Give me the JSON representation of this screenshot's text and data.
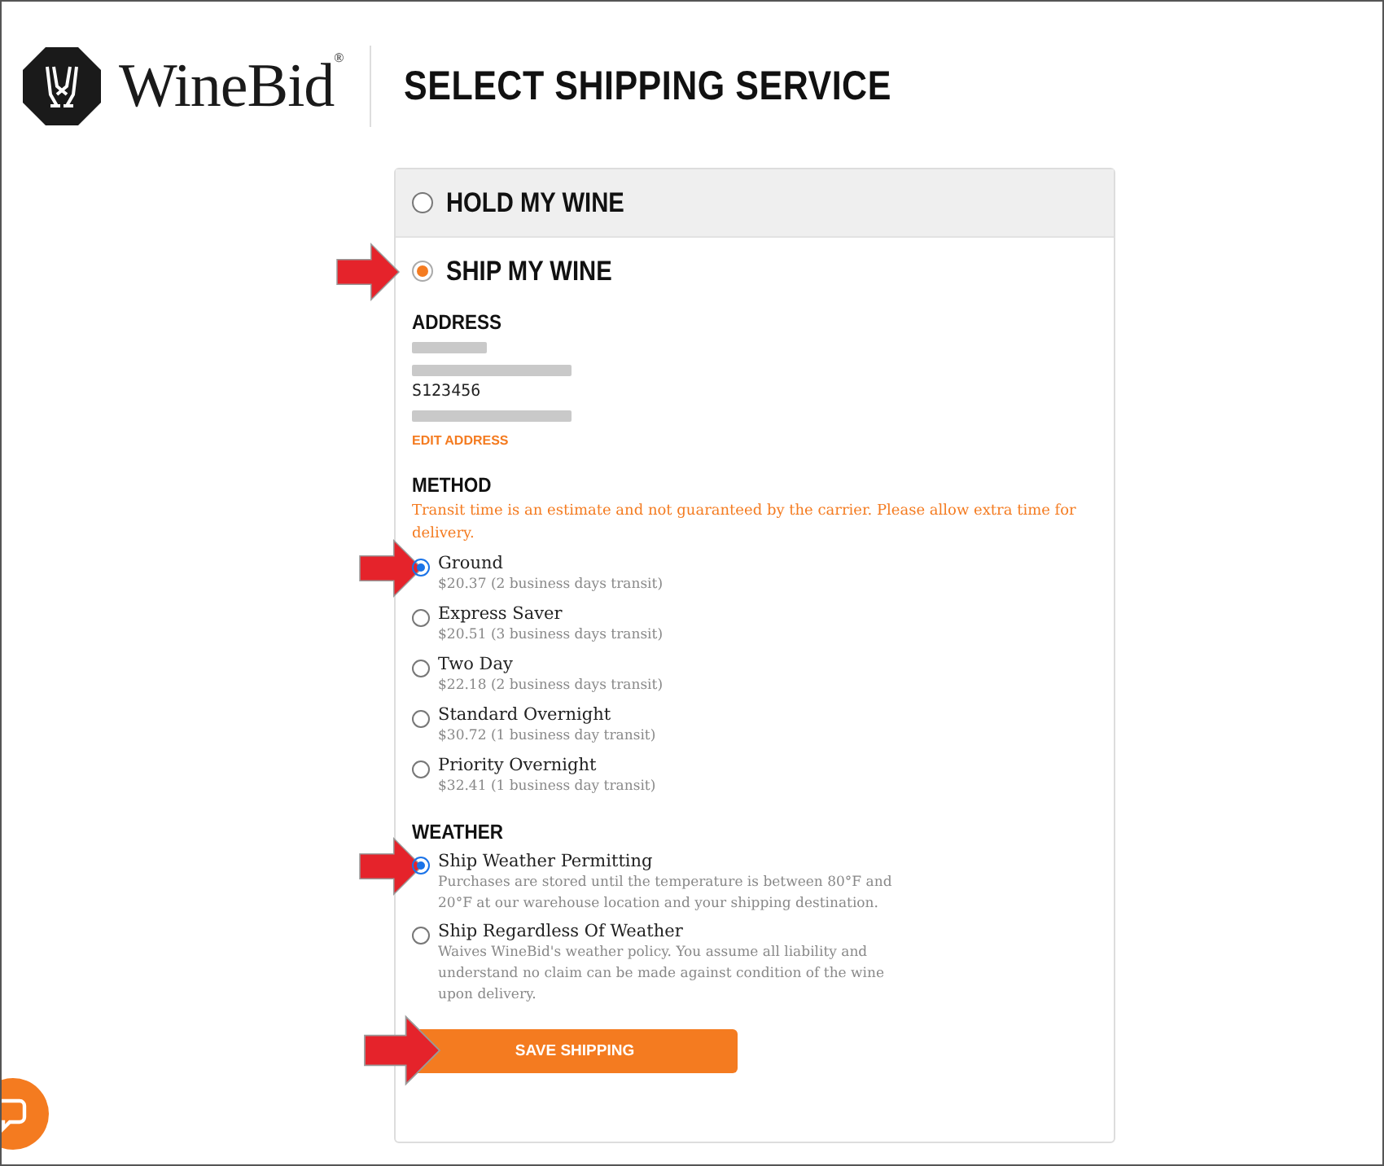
{
  "header": {
    "brand": "WineBid",
    "registered": "®",
    "title": "SELECT SHIPPING SERVICE"
  },
  "options": [
    {
      "label": "HOLD MY WINE",
      "selected": false,
      "arrow": false
    },
    {
      "label": "SHIP MY WINE",
      "selected": true,
      "arrow": true
    }
  ],
  "address": {
    "heading": "ADDRESS",
    "lines": [
      {
        "kind": "redacted"
      },
      {
        "kind": "redacted"
      },
      {
        "kind": "text",
        "text": "S123456"
      },
      {
        "kind": "redacted"
      }
    ],
    "edit_link": "EDIT ADDRESS"
  },
  "method": {
    "heading": "METHOD",
    "notice": "Transit time is an estimate and not guaranteed by the carrier. Please allow extra time for delivery.",
    "choices": [
      {
        "label": "Ground",
        "detail": "$20.37 (2 business days transit)",
        "selected": true,
        "arrow": true
      },
      {
        "label": "Express Saver",
        "detail": "$20.51 (3 business days transit)",
        "selected": false,
        "arrow": false
      },
      {
        "label": "Two Day",
        "detail": "$22.18 (2 business days transit)",
        "selected": false,
        "arrow": false
      },
      {
        "label": "Standard Overnight",
        "detail": "$30.72 (1 business day transit)",
        "selected": false,
        "arrow": false
      },
      {
        "label": "Priority Overnight",
        "detail": "$32.41 (1 business day transit)",
        "selected": false,
        "arrow": false
      }
    ]
  },
  "weather": {
    "heading": "WEATHER",
    "choices": [
      {
        "label": "Ship Weather Permitting",
        "detail": "Purchases are stored until the temperature is between 80°F and 20°F at our warehouse location and your shipping destination.",
        "selected": true,
        "arrow": true
      },
      {
        "label": "Ship Regardless Of Weather",
        "detail": "Waives WineBid's weather policy. You assume all liability and understand no claim can be made against condition of the wine upon delivery.",
        "selected": false,
        "arrow": false
      }
    ]
  },
  "save_button": {
    "label": "SAVE SHIPPING",
    "arrow": true
  }
}
